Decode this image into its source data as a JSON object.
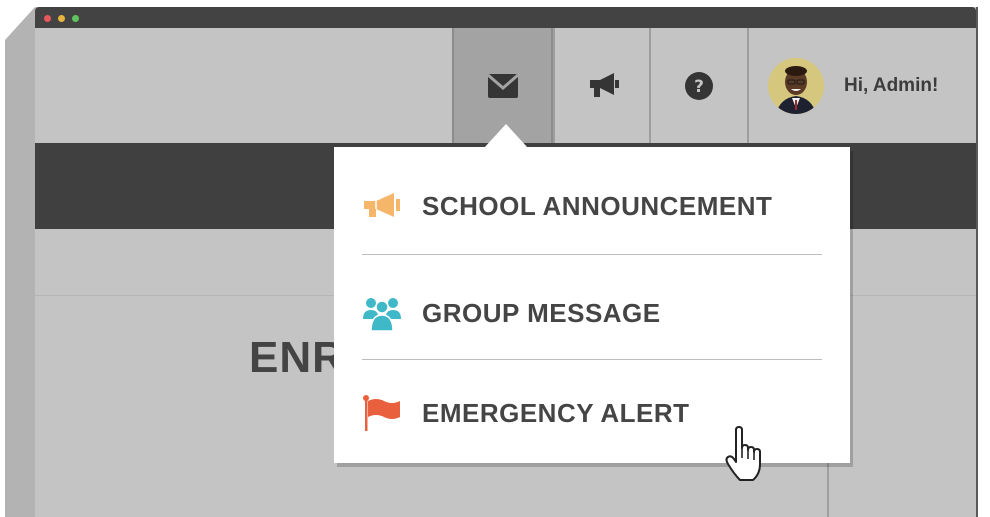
{
  "window": {
    "title_dots": [
      "close",
      "minimize",
      "maximize"
    ]
  },
  "header": {
    "nav_icons": [
      "envelope-icon",
      "megaphone-icon",
      "help-icon"
    ],
    "active_nav": "envelope-icon",
    "greeting": "Hi, Admin!"
  },
  "content": {
    "heading_partial": "ENR"
  },
  "dropdown": {
    "items": [
      {
        "label": "SCHOOL ANNOUNCEMENT",
        "icon": "megaphone-icon",
        "icon_color": "#f6b66a"
      },
      {
        "label": "GROUP MESSAGE",
        "icon": "group-icon",
        "icon_color": "#3fb8c8"
      },
      {
        "label": "EMERGENCY ALERT",
        "icon": "flag-icon",
        "icon_color": "#e8603e"
      }
    ]
  },
  "colors": {
    "titlebar": "#434343",
    "nav_bg": "#c4c4c4",
    "nav_active": "#a3a3a3",
    "dark_band": "#404040",
    "text_dark": "#454545"
  }
}
